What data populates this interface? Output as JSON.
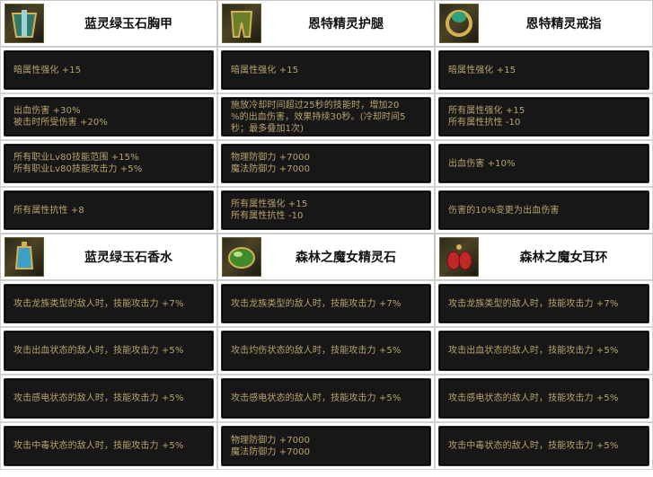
{
  "sections": [
    {
      "items": [
        {
          "name": "蓝灵绿玉石胸甲",
          "icon": "chestplate-icon",
          "stats": [
            [
              "暗属性强化 +15"
            ],
            [
              "出血伤害 +30%",
              "被击时所受伤害 +20%"
            ],
            [
              "所有职业Lv80技能范围 +15%",
              "所有职业Lv80技能攻击力 +5%"
            ],
            [
              "所有属性抗性 +8"
            ]
          ]
        },
        {
          "name": "恩特精灵护腿",
          "icon": "leggings-icon",
          "stats": [
            [
              "暗属性强化 +15"
            ],
            [
              "施放冷却时间超过25秒的技能时，增加20",
              "%的出血伤害，效果持续30秒。(冷却时间5",
              "秒；最多叠加1次)"
            ],
            [
              "物理防御力 +7000",
              "魔法防御力 +7000"
            ],
            [
              "所有属性强化 +15",
              "所有属性抗性 -10"
            ]
          ]
        },
        {
          "name": "恩特精灵戒指",
          "icon": "ring-icon",
          "stats": [
            [
              "暗属性强化 +15"
            ],
            [
              "所有属性强化 +15",
              "所有属性抗性 -10"
            ],
            [
              "出血伤害 +10%"
            ],
            [
              "伤害的10%变更为出血伤害"
            ]
          ]
        }
      ]
    },
    {
      "items": [
        {
          "name": "蓝灵绿玉石香水",
          "icon": "perfume-icon",
          "stats": [
            [
              "攻击龙族类型的敌人时，技能攻击力 +7%"
            ],
            [
              "攻击出血状态的敌人时，技能攻击力 +5%"
            ],
            [
              "攻击感电状态的敌人时，技能攻击力 +5%"
            ],
            [
              "攻击中毒状态的敌人时，技能攻击力 +5%"
            ]
          ]
        },
        {
          "name": "森林之魔女精灵石",
          "icon": "spirit-stone-icon",
          "stats": [
            [
              "攻击龙族类型的敌人时，技能攻击力 +7%"
            ],
            [
              "攻击灼伤状态的敌人时，技能攻击力 +5%"
            ],
            [
              "攻击感电状态的敌人时，技能攻击力 +5%"
            ],
            [
              "物理防御力 +7000",
              "魔法防御力 +7000"
            ]
          ]
        },
        {
          "name": "森林之魔女耳环",
          "icon": "earring-icon",
          "stats": [
            [
              "攻击龙族类型的敌人时，技能攻击力 +7%"
            ],
            [
              "攻击出血状态的敌人时，技能攻击力 +5%"
            ],
            [
              "攻击感电状态的敌人时，技能攻击力 +5%"
            ],
            [
              "攻击中毒状态的敌人时，技能攻击力 +5%"
            ]
          ]
        }
      ]
    }
  ],
  "colors": {
    "panel_bg": "#171717",
    "text": "#b8a36a",
    "title": "#111111"
  }
}
